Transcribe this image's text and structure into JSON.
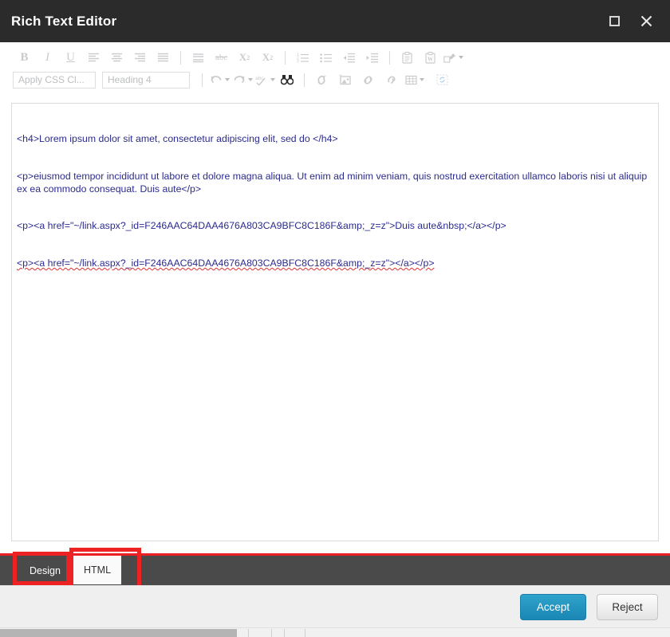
{
  "window": {
    "title": "Rich Text Editor",
    "maximize_icon": "maximize-icon",
    "close_icon": "close-icon"
  },
  "toolbar": {
    "row1": [
      {
        "name": "bold-button",
        "label": "B",
        "kind": "glyph-b",
        "enabled": false
      },
      {
        "name": "italic-button",
        "label": "I",
        "kind": "glyph-i",
        "enabled": false
      },
      {
        "name": "underline-button",
        "label": "U",
        "kind": "glyph-u",
        "enabled": false
      },
      {
        "name": "align-left-button",
        "label": "",
        "kind": "lines-left",
        "enabled": false
      },
      {
        "name": "align-center-button",
        "label": "",
        "kind": "lines-center",
        "enabled": false
      },
      {
        "name": "align-right-button",
        "label": "",
        "kind": "lines-right",
        "enabled": false
      },
      {
        "name": "align-justify-button",
        "label": "",
        "kind": "lines-justify",
        "enabled": false
      },
      {
        "name": "separator",
        "label": "",
        "kind": "sep",
        "enabled": false
      },
      {
        "name": "line-height-button",
        "label": "",
        "kind": "lines-spacing",
        "enabled": false
      },
      {
        "name": "strikethrough-button",
        "label": "abc",
        "kind": "glyph-strike",
        "enabled": false
      },
      {
        "name": "subscript-button",
        "label": "X",
        "kind": "glyph-sub-down",
        "enabled": false
      },
      {
        "name": "superscript-button",
        "label": "X",
        "kind": "glyph-sub-up",
        "enabled": false
      },
      {
        "name": "separator",
        "label": "",
        "kind": "sep",
        "enabled": false
      },
      {
        "name": "numbered-list-button",
        "label": "",
        "kind": "list-numbered",
        "enabled": false
      },
      {
        "name": "bulleted-list-button",
        "label": "",
        "kind": "list-bulleted",
        "enabled": false
      },
      {
        "name": "outdent-button",
        "label": "",
        "kind": "outdent",
        "enabled": false
      },
      {
        "name": "indent-button",
        "label": "",
        "kind": "indent",
        "enabled": false
      },
      {
        "name": "separator",
        "label": "",
        "kind": "sep",
        "enabled": false
      },
      {
        "name": "paste-button",
        "label": "",
        "kind": "clipboard",
        "enabled": false
      },
      {
        "name": "paste-from-word-button",
        "label": "",
        "kind": "clipboard-word",
        "enabled": false
      },
      {
        "name": "format-painter-button",
        "label": "",
        "kind": "painter",
        "enabled": false,
        "caret": true
      }
    ],
    "css_class_select": {
      "name": "apply-css-class-select",
      "value": "Apply CSS Cl...",
      "placeholder": "Apply CSS Cl..."
    },
    "paragraph_style_select": {
      "name": "paragraph-style-select",
      "value": "Heading 4",
      "placeholder": "Heading 4"
    },
    "row2": [
      {
        "name": "separator",
        "label": "",
        "kind": "sep",
        "enabled": false
      },
      {
        "name": "undo-button",
        "label": "",
        "kind": "undo",
        "enabled": false,
        "caret": true
      },
      {
        "name": "redo-button",
        "label": "",
        "kind": "redo",
        "enabled": false,
        "caret": true
      },
      {
        "name": "spellcheck-button",
        "label": "abc",
        "kind": "spellcheck",
        "enabled": false,
        "caret": true
      },
      {
        "name": "find-and-replace-button",
        "label": "",
        "kind": "binoculars",
        "enabled": true
      },
      {
        "name": "separator",
        "label": "",
        "kind": "sep",
        "enabled": false
      },
      {
        "name": "insert-link-button",
        "label": "",
        "kind": "link-add",
        "enabled": false
      },
      {
        "name": "insert-image-button",
        "label": "",
        "kind": "image-add",
        "enabled": false
      },
      {
        "name": "insert-anchor-button",
        "label": "",
        "kind": "link",
        "enabled": false
      },
      {
        "name": "remove-link-button",
        "label": "",
        "kind": "unlink",
        "enabled": false
      },
      {
        "name": "insert-table-button",
        "label": "",
        "kind": "table",
        "enabled": false,
        "caret": true
      },
      {
        "name": "module-manager-button",
        "label": "",
        "kind": "module",
        "enabled": false
      }
    ]
  },
  "code_editor": {
    "name": "html-source-textarea",
    "lines": [
      {
        "text": "<h4>Lorem ipsum dolor sit amet, consectetur adipiscing elit, sed do </h4>",
        "misspelled": false
      },
      {
        "text": "<p>eiusmod tempor incididunt ut labore et dolore magna aliqua. Ut enim ad minim veniam, quis nostrud exercitation ullamco laboris nisi ut aliquip ex ea commodo consequat. Duis aute</p>",
        "misspelled": false
      },
      {
        "text": "<p><a href=\"~/link.aspx?_id=F246AAC64DAA4676A803CA9BFC8C186F&amp;_z=z\">Duis aute&nbsp;</a></p>",
        "misspelled": false
      },
      {
        "text": "<p><a href=\"~/link.aspx?_id=F246AAC64DAA4676A803CA9BFC8C186F&amp;_z=z\"></a></p>",
        "misspelled": true
      }
    ]
  },
  "tabs": [
    {
      "name": "tab-design",
      "label": "Design",
      "active": false
    },
    {
      "name": "tab-html",
      "label": "HTML",
      "active": true
    }
  ],
  "footer": {
    "accept_label": "Accept",
    "reject_label": "Reject"
  },
  "colors": {
    "titlebar_bg": "#2b2b2b",
    "tabstrip_bg": "#4a4a4a",
    "annotation_red": "#ee2222",
    "accept_blue": "#2494bf",
    "code_text": "#2b2b8f",
    "spellcheck_red": "#e03030"
  }
}
